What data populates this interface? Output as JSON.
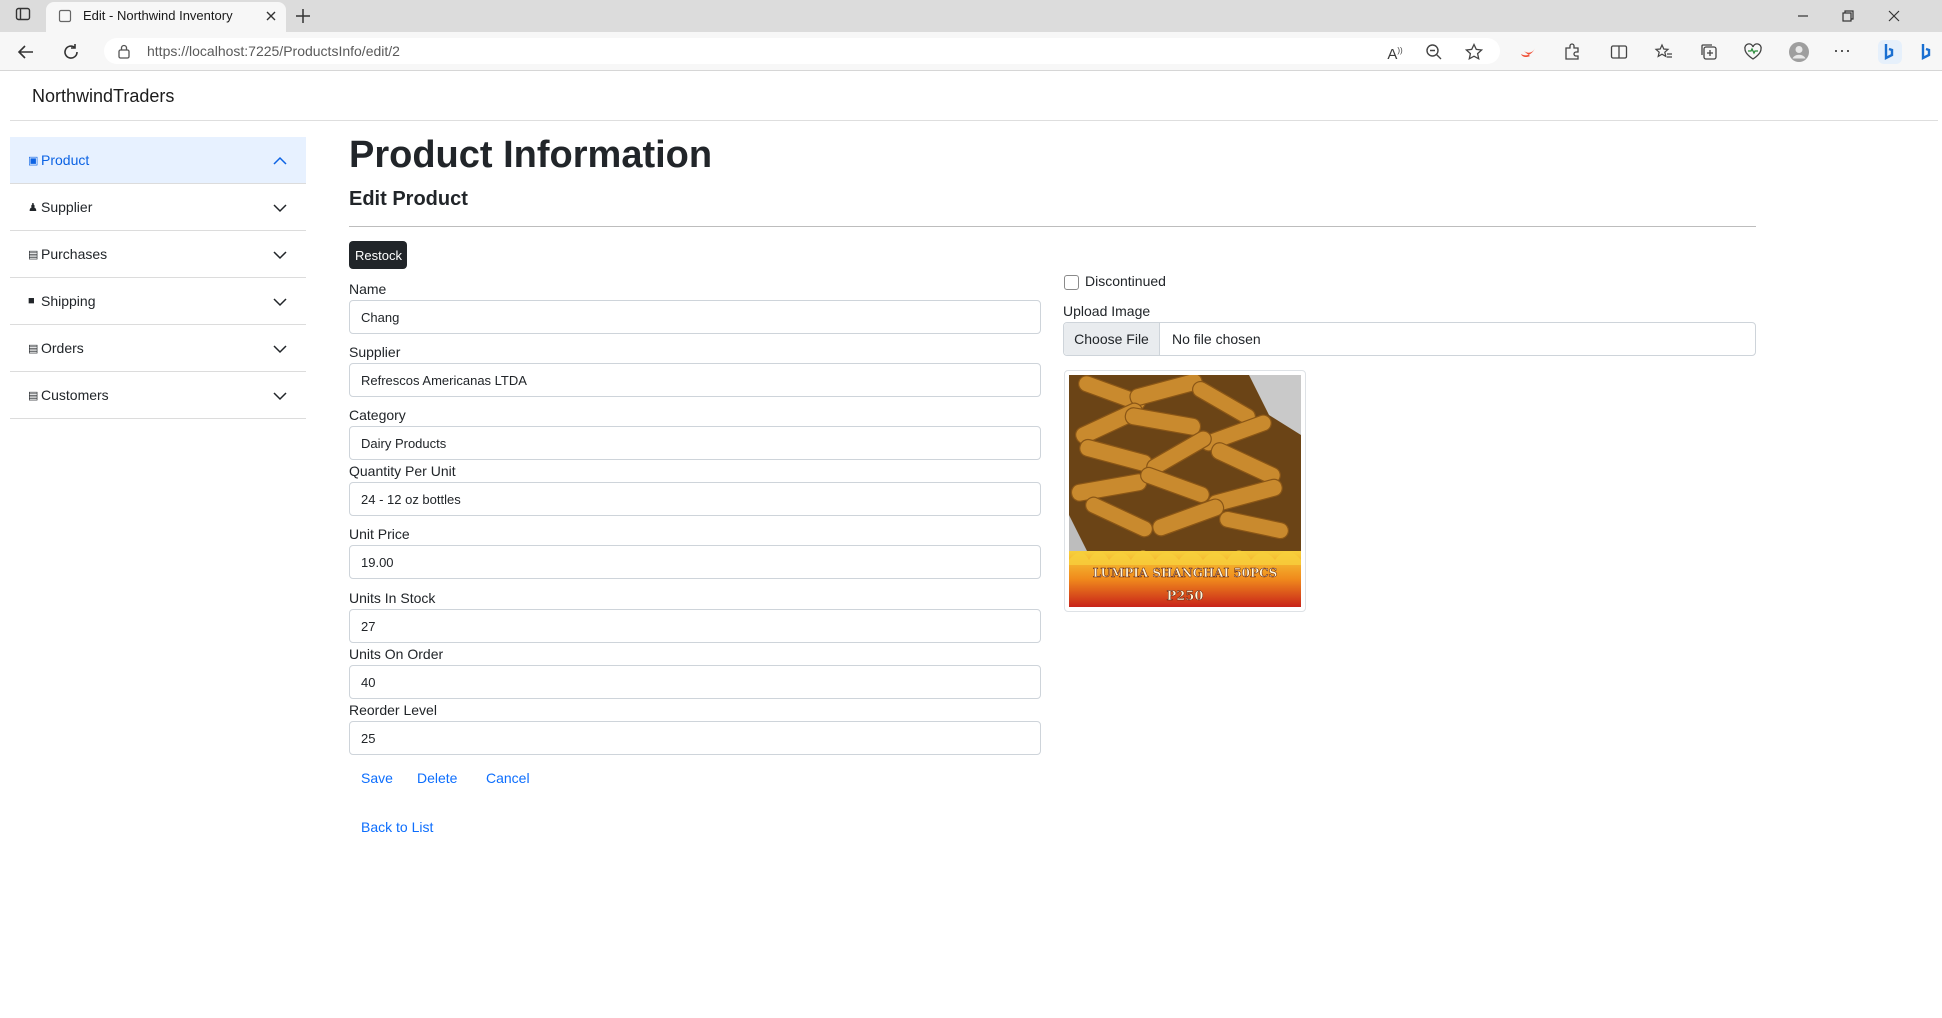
{
  "browser": {
    "tab_title": "Edit - Northwind Inventory",
    "url": "https://localhost:7225/ProductsInfo/edit/2"
  },
  "brand": "NorthwindTraders",
  "sidebar": {
    "items": [
      {
        "label": "Product",
        "icon": "box-icon",
        "active": true
      },
      {
        "label": "Supplier",
        "icon": "person-icon"
      },
      {
        "label": "Purchases",
        "icon": "document-icon"
      },
      {
        "label": "Shipping",
        "icon": "truck-icon"
      },
      {
        "label": "Orders",
        "icon": "document-icon"
      },
      {
        "label": "Customers",
        "icon": "document-icon"
      }
    ]
  },
  "page": {
    "title": "Product Information",
    "subtitle": "Edit Product"
  },
  "form": {
    "restock_label": "Restock",
    "fields": {
      "name": {
        "label": "Name",
        "value": "Chang"
      },
      "supplier": {
        "label": "Supplier",
        "value": "Refrescos Americanas LTDA"
      },
      "category": {
        "label": "Category",
        "value": "Dairy Products"
      },
      "quantity_per_unit": {
        "label": "Quantity Per Unit",
        "value": "24 - 12 oz bottles"
      },
      "unit_price": {
        "label": "Unit Price",
        "value": "19.00"
      },
      "units_in_stock": {
        "label": "Units In Stock",
        "value": "27"
      },
      "units_on_order": {
        "label": "Units On Order",
        "value": "40"
      },
      "reorder_level": {
        "label": "Reorder Level",
        "value": "25"
      }
    },
    "discontinued": {
      "label": "Discontinued",
      "checked": false
    },
    "upload": {
      "label": "Upload Image",
      "button": "Choose File",
      "status": "No file chosen"
    },
    "image_caption": "LUMPIA SHANGHAI 50PCS",
    "image_price": "P250",
    "actions": {
      "save": "Save",
      "delete": "Delete",
      "cancel": "Cancel"
    },
    "back_to_list": "Back to List"
  },
  "colors": {
    "accent": "#0d6efd",
    "active_bg": "#e7f1ff",
    "dark_button": "#212529"
  }
}
